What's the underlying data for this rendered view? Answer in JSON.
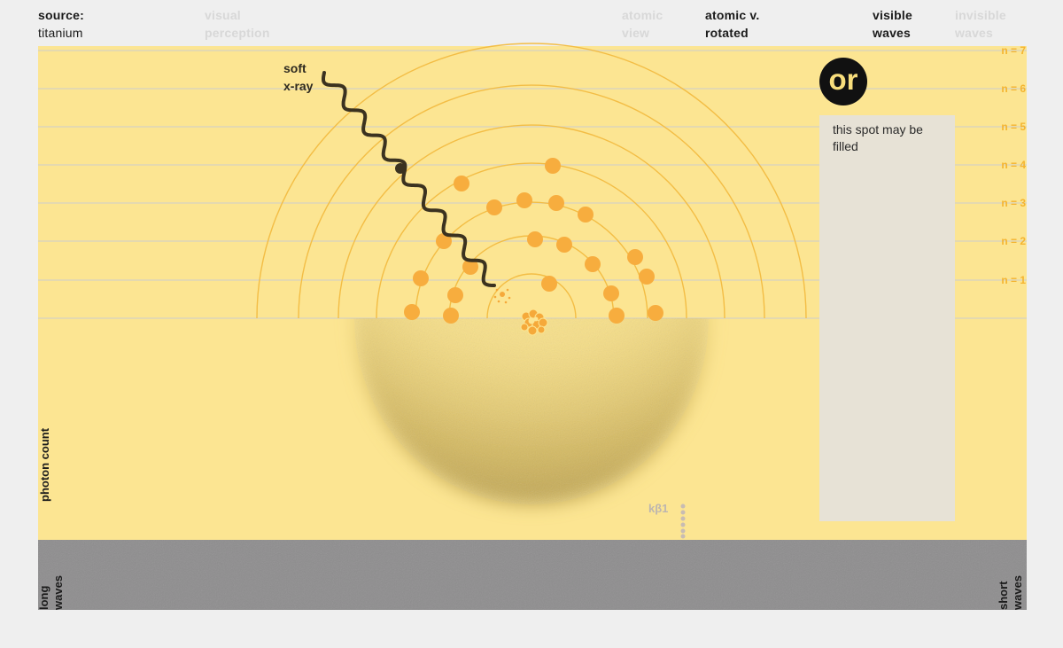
{
  "header": {
    "source": {
      "label": "source:",
      "value": "titanium"
    },
    "visual": {
      "line1": "visual",
      "line2": "perception"
    },
    "atomic_view": {
      "line1": "atomic",
      "line2": "view"
    },
    "atomic_rotated": {
      "line1": "atomic v.",
      "line2": "rotated"
    },
    "visible_waves": {
      "line1": "visible",
      "line2": "waves"
    },
    "invisible_waves": {
      "line1": "invisible",
      "line2": "waves"
    }
  },
  "diagram": {
    "xray_label": {
      "line1": "soft",
      "line2": "x-ray"
    },
    "badge": "or",
    "placeholder_text": "this spot may be filled",
    "y_axis_label": "photon count",
    "peak_label": "kβ1",
    "shell_labels": [
      "n = 1",
      "n = 2",
      "n = 3",
      "n = 4",
      "n = 5",
      "n = 6",
      "n = 7"
    ],
    "spectrum": {
      "left": {
        "line1": "long",
        "line2": "waves"
      },
      "right": {
        "line1": "short",
        "line2": "waves"
      }
    }
  },
  "colors": {
    "panel": "#fce592",
    "orbit": "#f3bd45",
    "electron": "#f7ad3e",
    "wave": "#3b3220",
    "spectrum_bar": "#8e8d8e",
    "placeholder": "#e7e2d6",
    "shell_label": "#f4b430"
  }
}
